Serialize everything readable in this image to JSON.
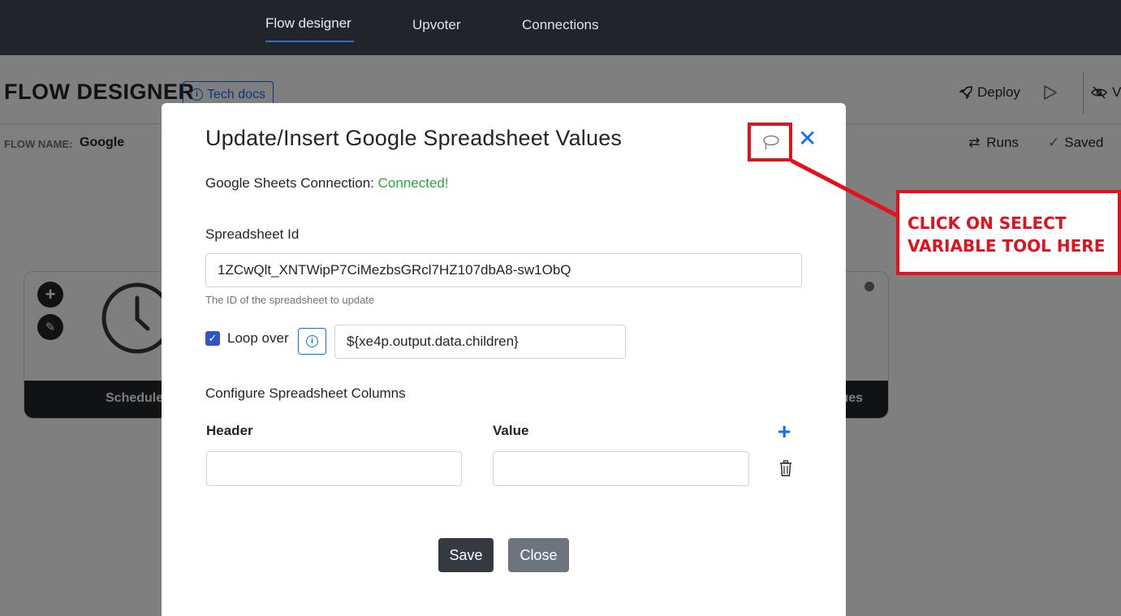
{
  "nav": {
    "tabs": [
      "Flow designer",
      "Upvoter",
      "Connections"
    ],
    "active_tab": "Flow designer"
  },
  "page": {
    "title": "FLOW DESIGNER",
    "tech_docs": "Tech docs",
    "deploy": "Deploy",
    "view_partial": "V",
    "flow_name_label": "FLOW NAME:",
    "flow_name": "Google",
    "runs": "Runs",
    "saved": "Saved",
    "node_left_label": "Schedule",
    "node_right_label": "lues"
  },
  "modal": {
    "title": "Update/Insert Google Spreadsheet Values",
    "connection_label": "Google Sheets Connection:",
    "connection_status": "Connected!",
    "spreadsheet_id_label": "Spreadsheet Id",
    "spreadsheet_id_value": "1ZCwQlt_XNTWipP7CiMezbsGRcl7HZ107dbA8-sw1ObQ",
    "spreadsheet_id_help": "The ID of the spreadsheet to update",
    "loop_over_label": "Loop over",
    "loop_over_checked": true,
    "loop_over_value": "${xe4p.output.data.children}",
    "configure_columns_label": "Configure Spreadsheet Columns",
    "header_label": "Header",
    "value_label": "Value",
    "header_value": "",
    "value_value": "",
    "save_label": "Save",
    "close_label": "Close"
  },
  "annotation": {
    "line1": "CLICK ON SELECT",
    "line2": "VARIABLE TOOL HERE"
  },
  "colors": {
    "nav_bg": "#212529",
    "accent": "#0d6efd",
    "connected": "#28a745",
    "annotation": "#e3111b",
    "save_btn": "#343a40",
    "close_btn": "#6c757d"
  },
  "icons": [
    "info-icon",
    "rocket-icon",
    "play-icon",
    "eye-slash-icon",
    "swap-arrows-icon",
    "check-icon",
    "plus-icon",
    "pencil-icon",
    "clock-icon",
    "lasso-icon",
    "close-icon",
    "trash-icon"
  ]
}
